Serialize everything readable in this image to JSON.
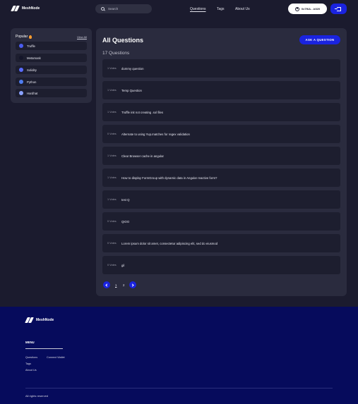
{
  "header": {
    "logo_text": "MeshNode",
    "search_placeholder": "Search",
    "nav": [
      "Questions",
      "Tags",
      "About Us"
    ],
    "wallet_address": "0x7f6A…b020",
    "accent": "#1a23e0"
  },
  "popular": {
    "title": "Popular",
    "view_all": "View All",
    "items": [
      {
        "label": "Truffle",
        "color": "#5b6cff"
      },
      {
        "label": "Metamask",
        "color": "#1d1e2f"
      },
      {
        "label": "Solidity",
        "color": "#6a7cff"
      },
      {
        "label": "Python",
        "color": "#5b8cff"
      },
      {
        "label": "Hardhat",
        "color": "#8aa2ff"
      }
    ]
  },
  "main": {
    "title": "All Questions",
    "ask_button": "ASK A QUESTION",
    "count": "17 Questions",
    "questions": [
      {
        "votes": "1 Votes",
        "title": "dummy question"
      },
      {
        "votes": "1 Votes",
        "title": "Temp Question"
      },
      {
        "votes": "1 Votes",
        "title": "Truffle init not creating .sol files"
      },
      {
        "votes": "0 Votes",
        "title": "Alternate to using Yup.matches for regex validation"
      },
      {
        "votes": "1 Votes",
        "title": "Clear Browser cache in angular"
      },
      {
        "votes": "1 Votes",
        "title": "How to display FormGroup with dynamic data in Angular reactive form?"
      },
      {
        "votes": "1 Votes",
        "title": "test Q"
      },
      {
        "votes": "0 Votes",
        "title": "QIOO"
      },
      {
        "votes": "0 Votes",
        "title": "Lorem ipsum dolor sit amet, consectetur adipiscing elit, sed do eiusmod"
      },
      {
        "votes": "0 Votes",
        "title": "gil"
      }
    ],
    "pagination": {
      "pages": [
        "1",
        "2"
      ]
    }
  },
  "footer": {
    "logo_text": "MeshNode",
    "menu_title": "MENU",
    "links": [
      "Questions",
      "Tags",
      "About Us",
      "Connect Wallet"
    ],
    "rights": "All rights reserved"
  }
}
